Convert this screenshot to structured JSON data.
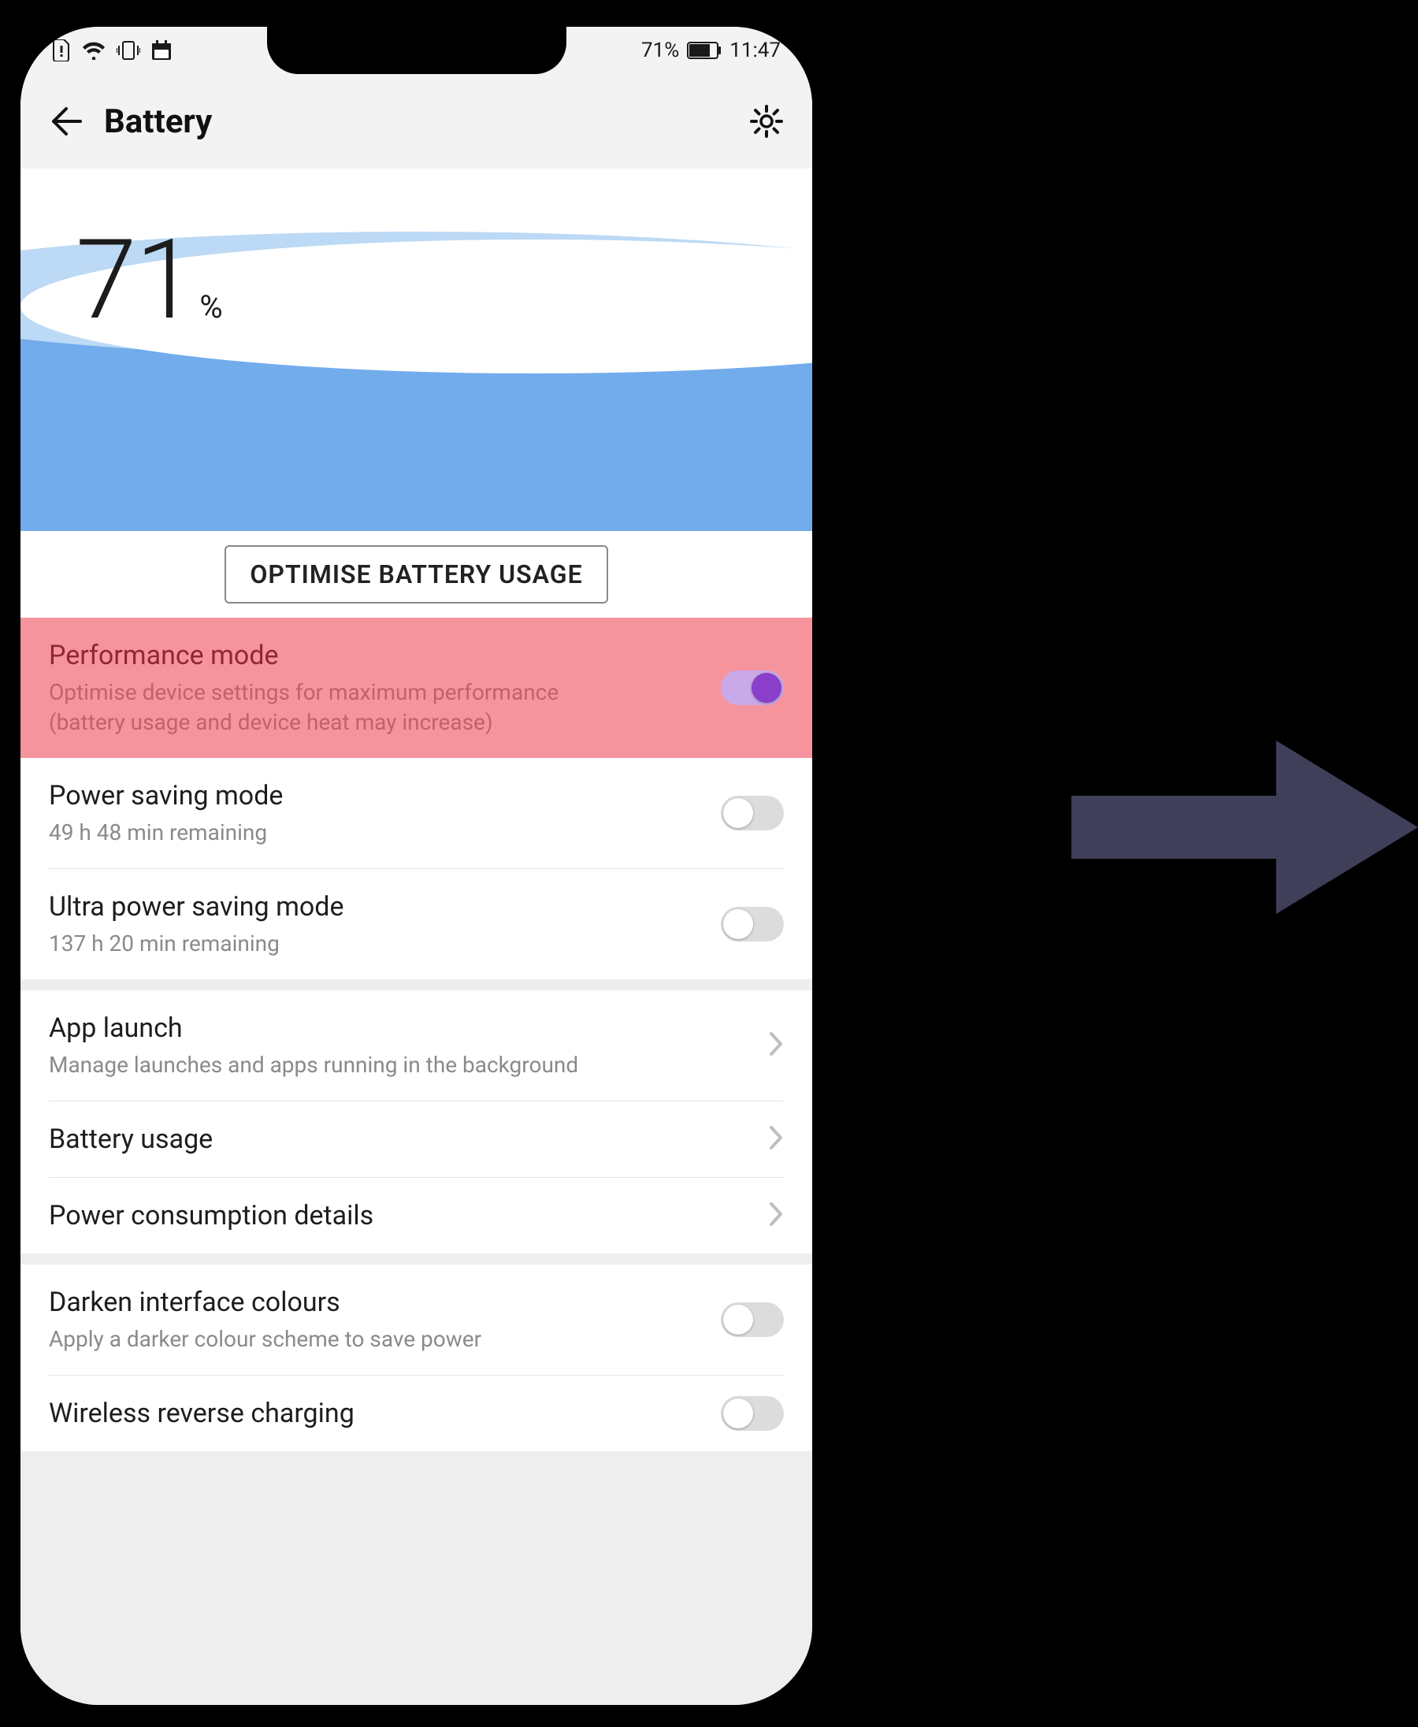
{
  "statusbar": {
    "battery_pct_text": "71%",
    "time": "11:47"
  },
  "header": {
    "title": "Battery"
  },
  "battery_wave": {
    "number": "71",
    "pct_symbol": "%"
  },
  "optimise_button_label": "OPTIMISE BATTERY USAGE",
  "modes": {
    "performance": {
      "label": "Performance mode",
      "subtitle": "Optimise device settings for maximum performance (battery usage and device heat may increase)",
      "enabled": true
    },
    "power_saving": {
      "label": "Power saving mode",
      "subtitle": "49 h 48 min remaining",
      "enabled": false
    },
    "ultra_power_saving": {
      "label": "Ultra power saving mode",
      "subtitle": "137 h 20 min remaining",
      "enabled": false
    }
  },
  "links": {
    "app_launch": {
      "label": "App launch",
      "subtitle": "Manage launches and apps running in the background"
    },
    "battery_usage": {
      "label": "Battery usage"
    },
    "power_consumption": {
      "label": "Power consumption details"
    }
  },
  "extras": {
    "darken": {
      "label": "Darken interface colours",
      "subtitle": "Apply a darker colour scheme to save power",
      "enabled": false
    },
    "wireless_reverse": {
      "label": "Wireless reverse charging"
    }
  }
}
